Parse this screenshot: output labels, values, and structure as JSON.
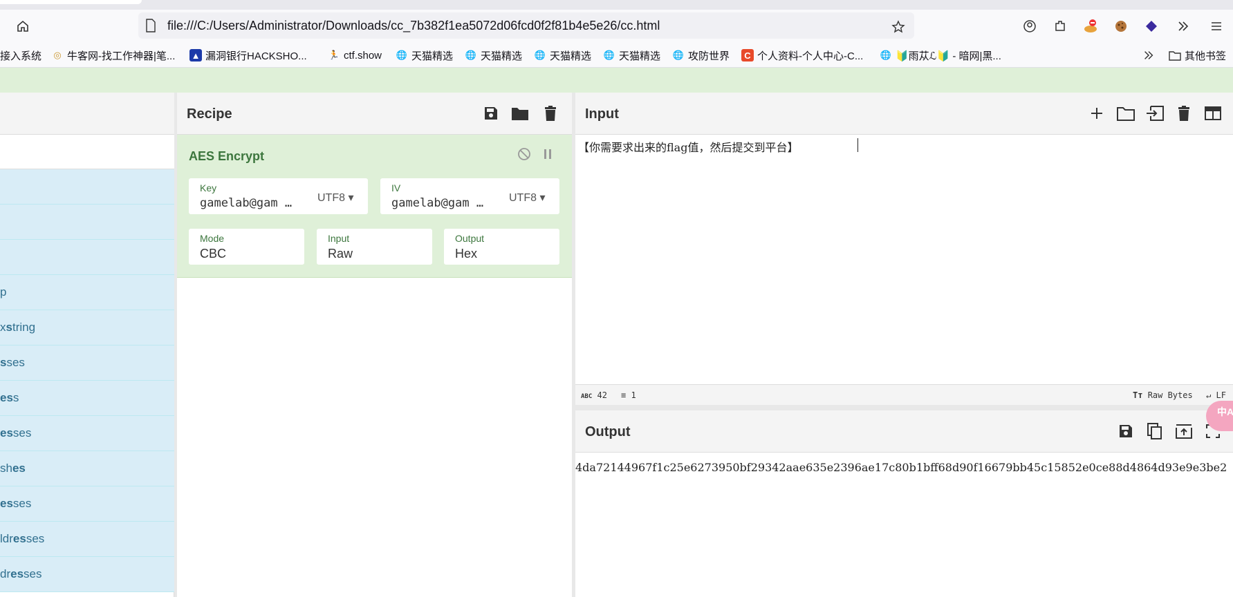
{
  "browser": {
    "url": "file:///C:/Users/Administrator/Downloads/cc_7b382f1ea5072d06fcd0f2f81b4e5e26/cc.html",
    "bookmarks": [
      {
        "label": "接入系统"
      },
      {
        "label": "牛客网-找工作神器|笔..."
      },
      {
        "label": "漏洞银行HACKSHO..."
      },
      {
        "label": "ctf.show"
      },
      {
        "label": "天猫精选"
      },
      {
        "label": "天猫精选"
      },
      {
        "label": "天猫精选"
      },
      {
        "label": "天猫精选"
      },
      {
        "label": "攻防世界"
      },
      {
        "label": "个人资料-个人中心-C..."
      },
      {
        "label": "🔰雨苁ℒ🔰 - 暗网|黑..."
      }
    ],
    "other_bookmarks": "其他书签"
  },
  "operations": {
    "items": [
      {
        "prefix": "",
        "bold": "",
        "suffix": ""
      },
      {
        "prefix": "",
        "bold": "",
        "suffix": ""
      },
      {
        "prefix": "",
        "bold": "",
        "suffix": ""
      },
      {
        "prefix": "p",
        "bold": "",
        "suffix": ""
      },
      {
        "prefix": "x ",
        "bold": "s",
        "suffix": "tring"
      },
      {
        "prefix": "",
        "bold": "s",
        "suffix": "ses"
      },
      {
        "prefix": "",
        "bold": "es",
        "suffix": "s"
      },
      {
        "prefix": "",
        "bold": "es",
        "suffix": "ses"
      },
      {
        "prefix": "sh",
        "bold": "es",
        "suffix": ""
      },
      {
        "prefix": "",
        "bold": "es",
        "suffix": "ses"
      },
      {
        "prefix": "ldr",
        "bold": "es",
        "suffix": "ses"
      },
      {
        "prefix": "dr",
        "bold": "es",
        "suffix": "ses"
      }
    ]
  },
  "recipe": {
    "title": "Recipe",
    "operation": {
      "name": "AES Encrypt",
      "key": {
        "label": "Key",
        "value": "gamelab@gam …",
        "encoding": "UTF8"
      },
      "iv": {
        "label": "IV",
        "value": "gamelab@gam …",
        "encoding": "UTF8"
      },
      "mode": {
        "label": "Mode",
        "value": "CBC"
      },
      "input": {
        "label": "Input",
        "value": "Raw"
      },
      "output": {
        "label": "Output",
        "value": "Hex"
      }
    }
  },
  "input": {
    "title": "Input",
    "text": "【你需要求出来的flag值，然后提交到平台】",
    "status": {
      "chars": "42",
      "lines": "1",
      "format": "Raw Bytes",
      "eol": "LF"
    }
  },
  "output": {
    "title": "Output",
    "text": "4da72144967f1c25e6273950bf29342aae635e2396ae17c80b1bff68d90f16679bb45c15852e0ce88d4864d93e9e3be2"
  },
  "badge": {
    "text": "中A"
  },
  "colors": {
    "accent_green": "#3c763d",
    "op_bg": "#d9edf7",
    "recipe_bg": "#dff0d8"
  }
}
